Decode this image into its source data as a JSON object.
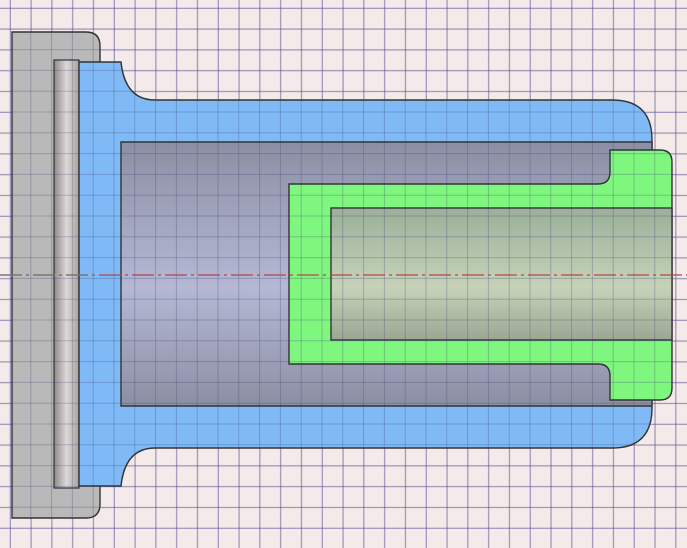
{
  "colors": {
    "background": "#f5eaea",
    "grid": "#7a6eb4",
    "flange_part": "#b9b9b9",
    "sleeve_part": "#7fbaf7",
    "insert_part": "#7ff77f",
    "bore_shade": "#9a9fbf",
    "centerline": "#b04848",
    "outline": "#333333"
  },
  "view": {
    "type": "cad-cross-section-view",
    "parts": [
      "flange-plate",
      "sleeve",
      "insert"
    ]
  }
}
